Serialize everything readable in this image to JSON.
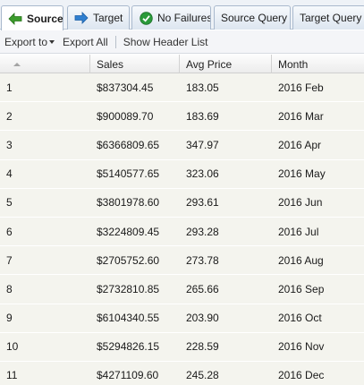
{
  "tabs": [
    {
      "label": "Source",
      "icon": "green-left-arrow-icon",
      "active": true
    },
    {
      "label": "Target",
      "icon": "blue-right-arrow-icon",
      "active": false
    },
    {
      "label": "No Failures",
      "icon": "green-check-circle-icon",
      "active": false
    },
    {
      "label": "Source Query",
      "icon": "",
      "active": false
    },
    {
      "label": "Target Query",
      "icon": "",
      "active": false
    }
  ],
  "toolbar": {
    "export_to": "Export to",
    "export_all": "Export All",
    "show_header_list": "Show Header List"
  },
  "grid": {
    "columns": [
      "",
      "Sales",
      "Avg Price",
      "Month"
    ],
    "rows": [
      [
        "1",
        "$837304.45",
        "183.05",
        "2016 Feb"
      ],
      [
        "2",
        "$900089.70",
        "183.69",
        "2016 Mar"
      ],
      [
        "3",
        "$6366809.65",
        "347.97",
        "2016 Apr"
      ],
      [
        "4",
        "$5140577.65",
        "323.06",
        "2016 May"
      ],
      [
        "5",
        "$3801978.60",
        "293.61",
        "2016 Jun"
      ],
      [
        "6",
        "$3224809.45",
        "293.28",
        "2016 Jul"
      ],
      [
        "7",
        "$2705752.60",
        "273.78",
        "2016 Aug"
      ],
      [
        "8",
        "$2732810.85",
        "265.66",
        "2016 Sep"
      ],
      [
        "9",
        "$6104340.55",
        "203.90",
        "2016 Oct"
      ],
      [
        "10",
        "$5294826.15",
        "228.59",
        "2016 Nov"
      ],
      [
        "11",
        "$4271109.60",
        "245.28",
        "2016 Dec"
      ]
    ]
  },
  "colors": {
    "row_bg": "#f4f4ee",
    "tab_border": "#a9b9cd",
    "arrow_green": "#3c9c2c",
    "arrow_blue": "#2f7fd0",
    "check_green": "#2a9a3a"
  }
}
